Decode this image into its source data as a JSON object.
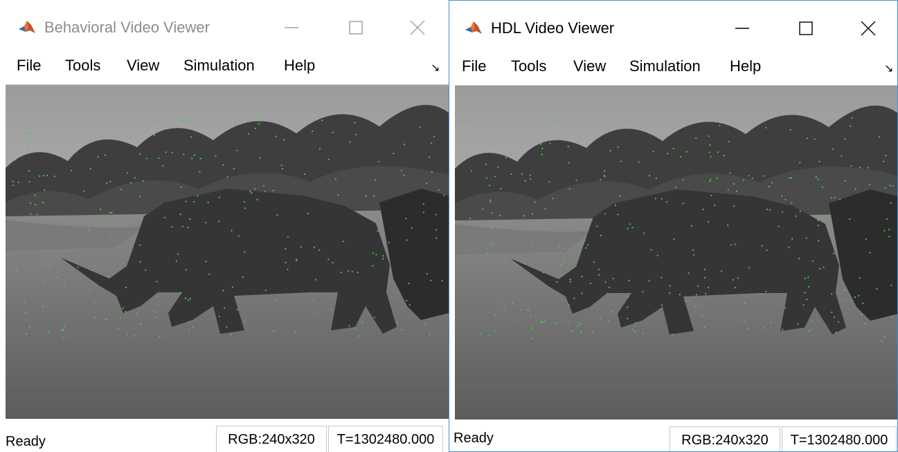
{
  "windows": [
    {
      "title": "Behavioral Video Viewer",
      "menu": [
        "File",
        "Tools",
        "View",
        "Simulation",
        "Help"
      ],
      "status": {
        "text": "Ready",
        "dimensions": "RGB:240x320",
        "time": "T=1302480.000"
      }
    },
    {
      "title": "HDL Video Viewer",
      "menu": [
        "File",
        "Tools",
        "View",
        "Simulation",
        "Help"
      ],
      "status": {
        "text": "Ready",
        "dimensions": "RGB:240x320",
        "time": "T=1302480.000"
      }
    }
  ],
  "icons": {
    "app": "matlab-logo-icon",
    "minimize": "minimize-icon",
    "maximize": "maximize-icon",
    "close": "close-icon",
    "dock": "undock-arrow-icon"
  },
  "colors": {
    "inactive_title": "#8c8c8c",
    "active_title": "#000000",
    "active_border": "#3b8ed8",
    "feature_points": "#3cd23c"
  }
}
